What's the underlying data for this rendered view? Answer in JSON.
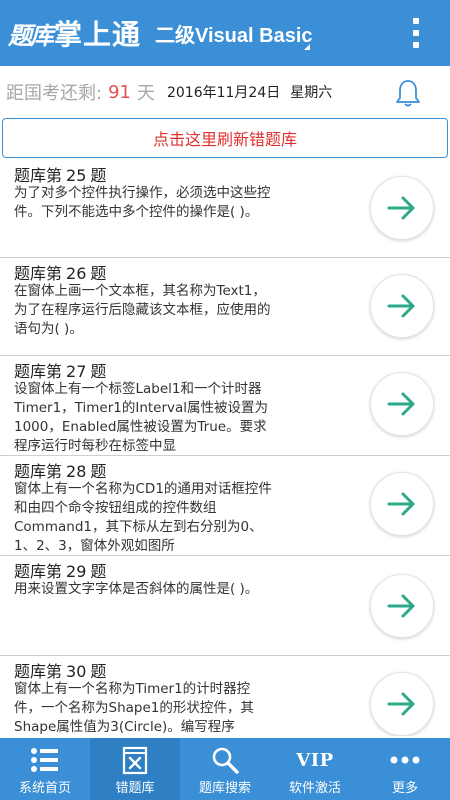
{
  "header": {
    "logo_prefix": "题库",
    "logo_main": "掌上通",
    "subtitle": "二级Visual  Basic"
  },
  "info": {
    "countdown_label": "距国考还剩:",
    "countdown_days": "91",
    "countdown_unit": "天",
    "date": "2016年11月24日",
    "weekday": "星期六"
  },
  "refresh_label": "点击这里刷新错题库",
  "items": [
    {
      "prefix": "题库第",
      "number": "25",
      "suffix": "题",
      "text": "为了对多个控件执行操作，必须选中这些控件。下列不能选中多个控件的操作是( )。"
    },
    {
      "prefix": "题库第",
      "number": "26",
      "suffix": "题",
      "text": "在窗体上画一个文本框，其名称为Text1，为了在程序运行后隐藏该文本框，应使用的语句为( )。"
    },
    {
      "prefix": "题库第",
      "number": "27",
      "suffix": "题",
      "text": "设窗体上有一个标签Label1和一个计时器Timer1，Timer1的Interval属性被设置为1000，Enabled属性被设置为True。要求程序运行时每秒在标签中显"
    },
    {
      "prefix": "题库第",
      "number": "28",
      "suffix": "题",
      "text": "窗体上有一个名称为CD1的通用对话框控件和由四个命令按钮组成的控件数组Command1，其下标从左到右分别为0、1、2、3，窗体外观如图所"
    },
    {
      "prefix": "题库第",
      "number": "29",
      "suffix": "题",
      "text": "用来设置文字字体是否斜体的属性是( )。"
    },
    {
      "prefix": "题库第",
      "number": "30",
      "suffix": "题",
      "text": "窗体上有一个名称为Timer1的计时器控件，一个名称为Shape1的形状控件，其Shape属性值为3(Circle)。编写程序"
    }
  ],
  "nav": [
    {
      "label": "系统首页",
      "icon": "list-icon"
    },
    {
      "label": "错题库",
      "icon": "error-book-icon"
    },
    {
      "label": "题库搜索",
      "icon": "search-icon"
    },
    {
      "label": "软件激活",
      "icon": "vip-icon",
      "icon_text": "VIP"
    },
    {
      "label": "更多",
      "icon": "more-icon"
    }
  ],
  "colors": {
    "primary": "#3a8fd6",
    "accent_red": "#e03030",
    "arrow": "#2ea88a"
  }
}
